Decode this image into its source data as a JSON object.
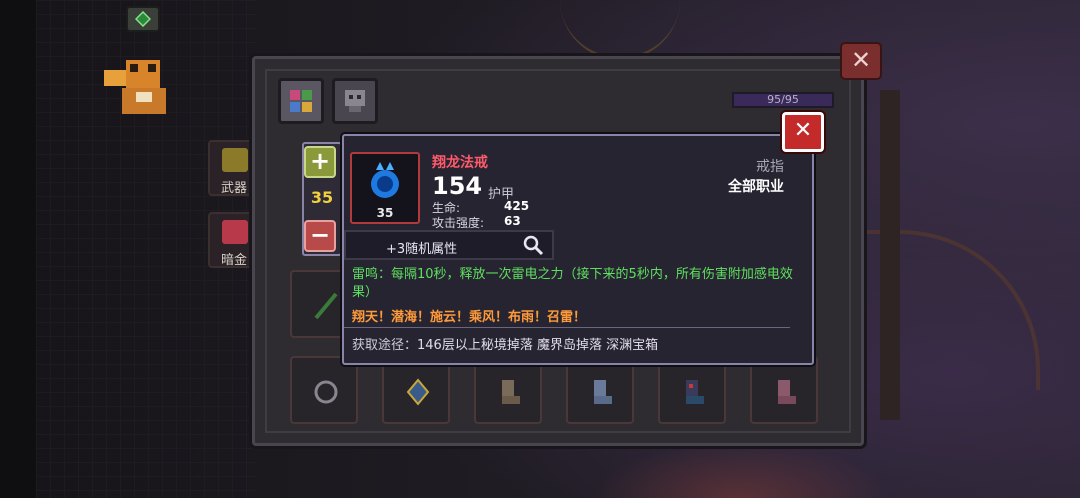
{
  "side_menu": {
    "weapon_label": "武器",
    "dark_gold_label": "暗金"
  },
  "inventory": {
    "hp_text": "95/95"
  },
  "level_stepper": {
    "level": "35",
    "plus_label": "+",
    "minus_label": "−"
  },
  "tooltip": {
    "item_name": "翔龙法戒",
    "icon_level": "35",
    "armor_value": "154",
    "armor_label": "护甲",
    "stats": [
      {
        "label": "生命:",
        "value": "425"
      },
      {
        "label": "攻击强度:",
        "value": "63"
      }
    ],
    "item_type": "戒指",
    "class_req": "全部职业",
    "random_attrs": "+3随机属性",
    "effect": "雷鸣：每隔10秒，释放一次雷电之力（接下来的5秒内，所有伤害附加感电效果）",
    "quote": "翔天！潜海！施云！乘风！布雨！召雷！",
    "source_label": "获取途径：",
    "source_value": "146层以上秘境掉落 魔界岛掉落 深渊宝箱"
  },
  "close_label": "✕",
  "colors": {
    "item_name": "#ff5a6a",
    "effect_text": "#5fe05f",
    "quote_text": "#ff9a3a",
    "close_button": "#c42a2a",
    "level_text": "#f0d040"
  },
  "icons": [
    "grid-icon",
    "helmet-icon",
    "magnifier-icon",
    "ring-icon",
    "amulet-icon",
    "boots-icon",
    "chest-icon",
    "close-icon",
    "plus-icon",
    "minus-icon"
  ]
}
